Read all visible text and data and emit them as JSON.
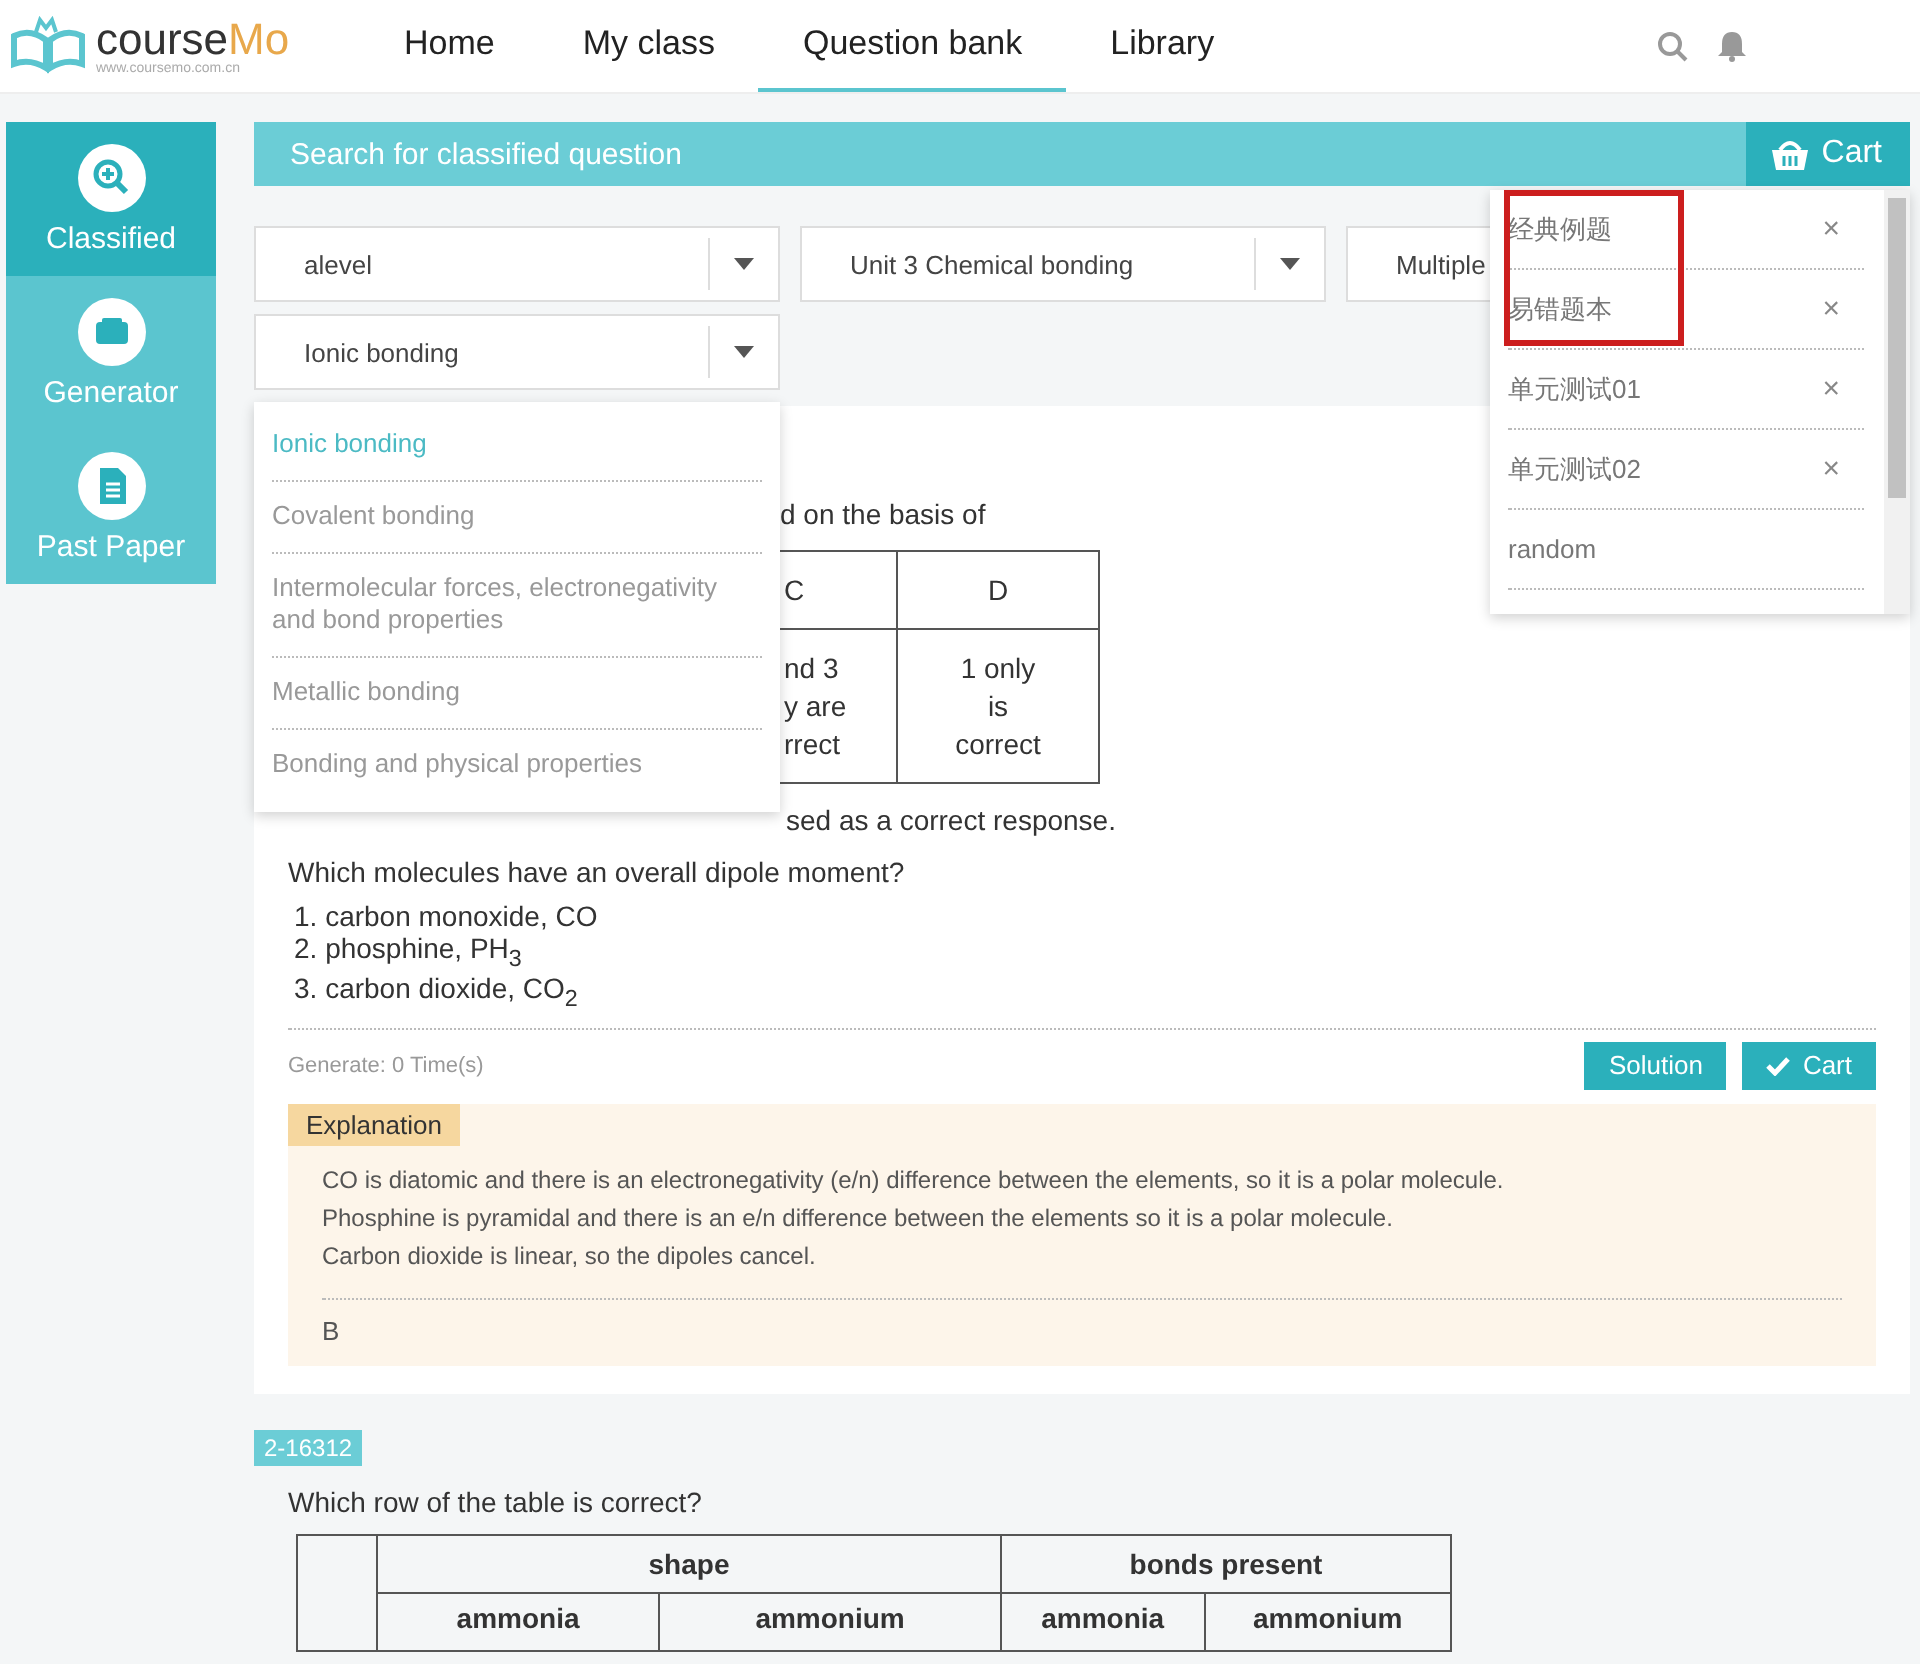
{
  "header": {
    "logo": {
      "name": "course",
      "name_accent": "Mo",
      "url": "www.coursemo.com.cn"
    },
    "nav": [
      {
        "label": "Home",
        "selected": false
      },
      {
        "label": "My class",
        "selected": false
      },
      {
        "label": "Question bank",
        "selected": true
      },
      {
        "label": "Library",
        "selected": false
      }
    ]
  },
  "sidebar": {
    "items": [
      {
        "label": "Classified",
        "kind": "search",
        "selected": true
      },
      {
        "label": "Generator",
        "kind": "box",
        "selected": false
      },
      {
        "label": "Past Paper",
        "kind": "document",
        "selected": false
      }
    ]
  },
  "search_bar": {
    "title": "Search for classified question",
    "cart_label": "Cart"
  },
  "filters": [
    {
      "value": "alevel",
      "caret": true
    },
    {
      "value": "Unit 3 Chemical bonding",
      "caret": true
    },
    {
      "value": "Multiple"
    },
    {
      "value": "Ionic bonding",
      "caret": true
    }
  ],
  "topic_dropdown": {
    "options": [
      {
        "label": "Ionic bonding",
        "selected": true
      },
      {
        "label": "Covalent bonding",
        "selected": false
      },
      {
        "label": "Intermolecular forces, electronegativity and bond properties",
        "selected": false
      },
      {
        "label": "Metallic bonding",
        "selected": false
      },
      {
        "label": "Bonding and physical properties",
        "selected": false
      }
    ]
  },
  "cart_menu": {
    "items": [
      {
        "label": "经典例题",
        "remove_glyph": "×",
        "highlighted": true
      },
      {
        "label": "易错题本",
        "remove_glyph": "×",
        "highlighted": true
      },
      {
        "label": "单元测试01",
        "remove_glyph": "×",
        "highlighted": false
      },
      {
        "label": "单元测试02",
        "remove_glyph": "×",
        "highlighted": false
      },
      {
        "label": "random",
        "highlighted": false
      }
    ]
  },
  "question1": {
    "intro": "d on the basis of",
    "table": {
      "headers": [
        "C",
        "D"
      ],
      "cells": [
        [
          "nd 3",
          "y are",
          "rrect"
        ],
        [
          "1 only",
          "is",
          "correct"
        ]
      ]
    },
    "note": "sed as a correct response.",
    "prompt": "Which molecules have an overall dipole moment?",
    "statements": [
      "1. carbon monoxide, CO",
      "2. phosphine, PH$_{3}$",
      "3. carbon dioxide, CO$_{2}$"
    ],
    "generate": "Generate: 0 Time(s)",
    "solution_button": "Solution",
    "cart_button": "Cart",
    "explanation": {
      "label": "Explanation",
      "lines": [
        "CO is diatomic and there is an electronegativity (e/n) difference between the elements, so it is a polar molecule.",
        "Phosphine is pyramidal and there is an e/n difference between the elements so it is a polar molecule.",
        "Carbon dioxide is linear, so the dipoles cancel."
      ],
      "answer": "B"
    }
  },
  "question2": {
    "id": "2-16312",
    "prompt": "Which row of the table is correct?",
    "table": {
      "groups": [
        "shape",
        "bonds present"
      ],
      "subheaders": [
        "ammonia",
        "ammonium",
        "ammonia",
        "ammonium"
      ]
    }
  }
}
